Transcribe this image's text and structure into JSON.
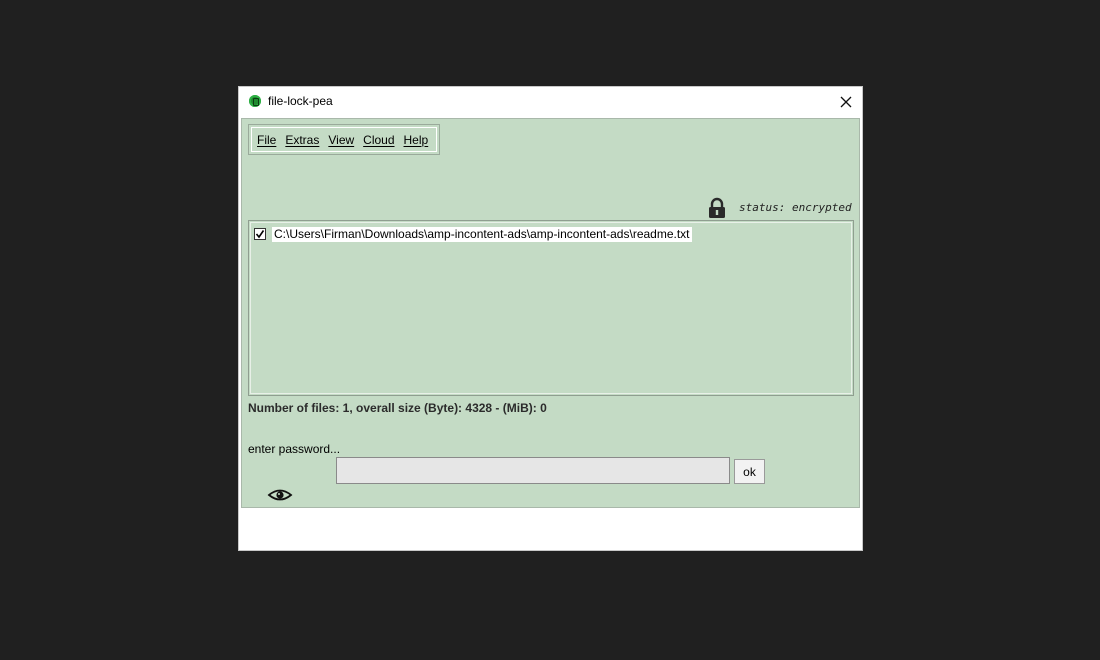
{
  "window": {
    "title": "file-lock-pea"
  },
  "menu": {
    "items": [
      {
        "label": "File",
        "mnemonic": "F"
      },
      {
        "label": "Extras",
        "mnemonic": "E"
      },
      {
        "label": "View",
        "mnemonic": "V"
      },
      {
        "label": "Cloud",
        "mnemonic": "C"
      },
      {
        "label": "Help",
        "mnemonic": "H"
      }
    ]
  },
  "status": {
    "text": "status: encrypted",
    "icon": "lock-icon"
  },
  "files": [
    {
      "path": "C:\\Users\\Firman\\Downloads\\amp-incontent-ads\\amp-incontent-ads\\readme.txt",
      "checked": true
    }
  ],
  "summary": "Number of files: 1, overall size (Byte): 4328 - (MiB): 0",
  "password": {
    "label": "enter password...",
    "value": "",
    "ok_label": "ok",
    "toggle_icon": "eye-icon"
  },
  "colors": {
    "panel_background": "#c4dbc5",
    "desktop_background": "#202020"
  }
}
